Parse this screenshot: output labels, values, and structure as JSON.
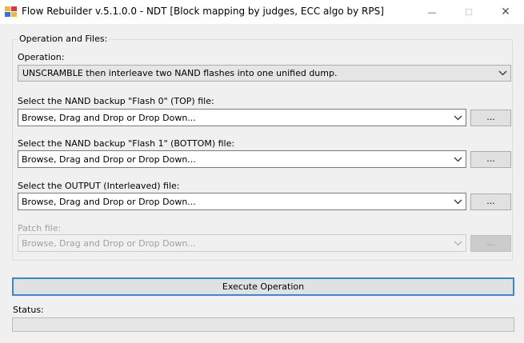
{
  "window": {
    "title": "Flow Rebuilder v.5.1.0.0 - NDT [Block mapping by judges, ECC algo by RPS]",
    "min_glyph": "—",
    "max_glyph": "☐",
    "close_glyph": "✕"
  },
  "group": {
    "legend": "Operation and Files:",
    "operation_label": "Operation:",
    "operation_value": "UNSCRAMBLE then interleave two NAND flashes into one unified dump."
  },
  "files": [
    {
      "label": "Select the NAND backup \"Flash 0\" (TOP) file:",
      "value": "Browse, Drag and Drop or Drop Down...",
      "button": "...",
      "enabled": true
    },
    {
      "label": "Select the NAND backup \"Flash 1\" (BOTTOM) file:",
      "value": "Browse, Drag and Drop or Drop Down...",
      "button": "...",
      "enabled": true
    },
    {
      "label": "Select the OUTPUT (Interleaved) file:",
      "value": "Browse, Drag and Drop or Drop Down...",
      "button": "...",
      "enabled": true
    },
    {
      "label": "Patch file:",
      "value": "Browse, Drag and Drop or Drop Down...",
      "button": "...",
      "enabled": false
    }
  ],
  "execute_label": "Execute Operation",
  "status": {
    "label": "Status:",
    "progress": 0
  },
  "colors": {
    "accent": "#3c86d8",
    "progress": "#06b025"
  },
  "icons": {
    "app": "flow-rebuilder-app-icon",
    "dropdown": "chevron-down-icon",
    "minimize": "minimize-icon",
    "maximize": "maximize-icon",
    "close": "close-icon"
  }
}
